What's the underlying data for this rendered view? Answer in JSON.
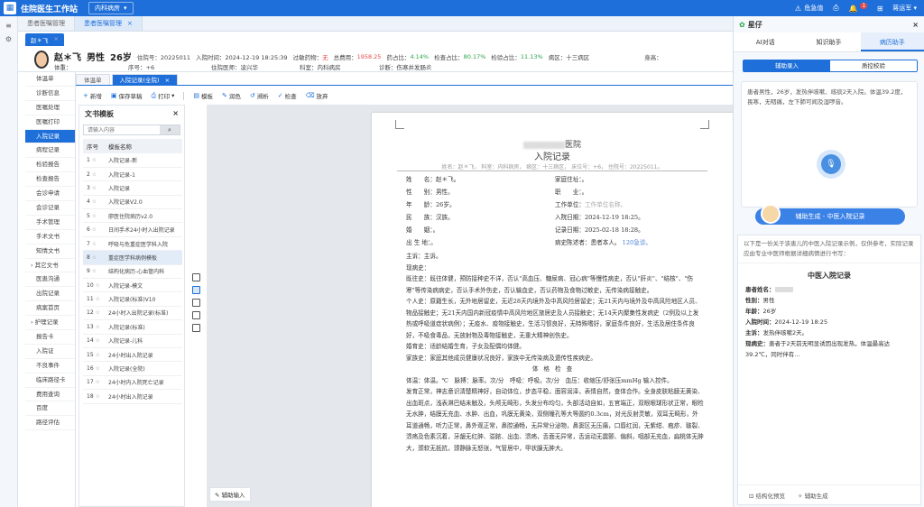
{
  "app": {
    "title": "住院医生工作站",
    "dept": "内科病房",
    "user_status": "危急值",
    "notifications": "1",
    "user": "蒋运军"
  },
  "tabs": [
    "患者医嘱管理",
    "患者医嘱管理"
  ],
  "patient_tab": "赵＊飞",
  "patient": {
    "name": "赵＊飞",
    "gender": "男性",
    "age": "26岁",
    "bed_label": "住院号：20225011",
    "admit_time": "入院时间：2024-12-19 18:25:39",
    "allergy_label": "过敏药物：",
    "allergy_value": "无",
    "total_cost_label": "总费用：",
    "total_cost": "1958.25",
    "drug_ratio_label": "药占比：",
    "drug_ratio": "4.14%",
    "exam_ratio_label": "检查占比：",
    "exam_ratio": "80.17%",
    "test_ratio_label": "检验占比：",
    "test_ratio": "11.13%",
    "ward": "病区：十三病区",
    "id_label": "身高：",
    "weight_label": "体重：",
    "seq": "序号：+6",
    "doctor": "住院医师：凌兴华",
    "dept_label": "科室：内科病房",
    "diag": "诊断：伤寒并发肠炎"
  },
  "sidenav": [
    "体温单",
    "诊断信息",
    "医嘱处理",
    "医嘱打印",
    "入院记录",
    "病程记录",
    "检验报告",
    "检查报告",
    "会诊申请",
    "会诊记录",
    "手术管理",
    "手术文书",
    "知情文书",
    "其它文书",
    "医患沟通",
    "出院记录",
    "病案首页",
    "护理记录",
    "报告卡",
    "入院证",
    "不良事件",
    "临床路径卡",
    "费用查询",
    "百度",
    "路径评估"
  ],
  "record_tabs": [
    "体温单",
    "入院记录(全院)"
  ],
  "toolbar": [
    "新增",
    "保存草稿",
    "打印",
    "模板",
    "润色",
    "溯析",
    "检查",
    "放弃"
  ],
  "template_panel": {
    "title": "文书模板",
    "search_placeholder": "请输入内容",
    "col_no": "序号",
    "col_name": "模板名称",
    "rows": [
      {
        "no": "1",
        "name": "入院记录-新"
      },
      {
        "no": "2",
        "name": "入院记录-1"
      },
      {
        "no": "3",
        "name": "入院记录"
      },
      {
        "no": "4",
        "name": "入院记录V2.0"
      },
      {
        "no": "5",
        "name": "廖医住院病历v2.0"
      },
      {
        "no": "6",
        "name": "日间手术24小时入出院记录"
      },
      {
        "no": "7",
        "name": "呼吸与危重症医学科入院"
      },
      {
        "no": "8",
        "name": "重症医学科病例模板"
      },
      {
        "no": "9",
        "name": "结构化病历-心血管内科"
      },
      {
        "no": "10",
        "name": "入院记录-模文"
      },
      {
        "no": "11",
        "name": "入院记录(标准)V10"
      },
      {
        "no": "12",
        "name": "24小时入出院记录(标准)"
      },
      {
        "no": "13",
        "name": "入院记录(标准)"
      },
      {
        "no": "14",
        "name": "入院记录-儿科"
      },
      {
        "no": "15",
        "name": "24小时出入院记录"
      },
      {
        "no": "16",
        "name": "入院记录(全院)"
      },
      {
        "no": "17",
        "name": "24小时内入院死亡记录"
      },
      {
        "no": "18",
        "name": "24小时出入院记录"
      }
    ]
  },
  "doc": {
    "hospital_suffix": "医院",
    "title": "入院记录",
    "meta": "姓名：赵＊飞，  科室：内科病房，  病区：十三病区，  床位号：+6，  住院号：20225011。",
    "f_name_l": "姓　　名：",
    "f_name": "赵＊飞。",
    "f_addr_l": "家庭住址：",
    "f_addr": "。",
    "f_gender_l": "性　　别：",
    "f_gender": "男性。",
    "f_job_l": "职　　业：",
    "f_job": "。",
    "f_age_l": "年　　龄：",
    "f_age": "26岁。",
    "f_work_l": "工作单位：",
    "f_work": "工作单位名称。",
    "f_nation_l": "民　　族：",
    "f_nation": "汉族。",
    "f_admit_l": "入院日期：",
    "f_admit": "2024-12-19 18:25。",
    "f_marry_l": "婚　　姻：",
    "f_marry": "。",
    "f_record_l": "记录日期：",
    "f_record": "2025-02-18 18:28。",
    "f_birth_l": "出 生 地：",
    "f_birth": "。",
    "f_narr_l": "病史陈述者：",
    "f_narr": "患者本人。",
    "f_rel": "120急诊。",
    "complaint": "主诉：主诉。",
    "hpi": "现病史：",
    "past": "既往史：既往体健，预防接种史不详，否认\"高血压、糖尿病、冠心病\"等慢性病史，否认\"肝炎\"、\"结核\"、\"伤寒\"等传染病病史，否认手术外伤史，否认输血史，否认药物及食物过敏史，无传染病接触史。",
    "personal": "个人史：原籍生长，无外地居留史，无近28天内境外及中高风险居留史；无21天内与境外及中高风险地区人员、物品接触史；无21天内国内新冠疫情中高风险地区旅居史及人员接触史；无14天内聚集性发病史（2例及以上发热或呼吸道症状病例）；无疫水、疫物接触史，生活习惯良好，无特殊嗜好，家庭条件良好，生活及居住条件良好，不吸食毒品，无放射物及毒物接触史，无重大精神创伤史。",
    "marital": "婚育史：适龄结婚生育，子女及配偶均体健。",
    "family": "家族史：家庭其他成员健康状况良好，家族中无传染病及遗传性疾病史。",
    "exam_title": "体格检查",
    "vitals": "体温：体温。℃　脉搏：脉率。次/分　呼吸：呼吸。次/分　血压：收缩压/舒张压mmHg 输入控件。",
    "exam": "发育正常，神志意识清楚精神好，自动体位，步态平稳，面容润泽，表情自然，查体合作。全身皮肤粘膜无黄染、出血斑点，浅表淋巴结未触及，头颅无畸形，头发分布均匀，头部活动自如，五官端正，双眼眼球形状正常，眼睑无水肿，结膜无充血、水肿、出血，巩膜无黄染，双侧瞳孔等大等圆约0.3cm，对光反射灵敏，双耳无畸形，外耳道通畅，听力正常，鼻外观正常，鼻腔通畅，无异常分泌物，鼻窦区无压痛，口唇红润，无紫绀、疱疹、皲裂、溃疡及色素沉着，牙龈无红肿、溢脓、出血、溃疡，舌面无异常，舌运动无震颤、偏斜，咽部无充血，扁桃体无肿大，颈软无抵抗，颈静脉无怒张，气管居中，甲状腺无肿大。"
  },
  "bottom_tip": "辅助输入",
  "assistant": {
    "title": "星仔",
    "tabs": [
      "AI对话",
      "知识助手",
      "病历助手"
    ],
    "seg": [
      "辅助录入",
      "质控校验"
    ],
    "note": "患者男性，26岁，发热伴咳嗽、咳痰2天入院。体温39.2度，畏寒，无咽痛，左下肺可闻及湿啰音。",
    "gen_button": "辅助生成 - 中医入院记录",
    "intro": "以下是一份关于该患儿的中医入院记录示例，仅供参考，实际记录应由专业中医师根据详细病情进行书写：",
    "record_title": "中医入院记录",
    "rows": [
      {
        "k": "患者姓名：",
        "v": ""
      },
      {
        "k": "性别：",
        "v": "男性"
      },
      {
        "k": "年龄：",
        "v": "26岁"
      },
      {
        "k": "入院时间：",
        "v": "2024-12-19 18:25"
      },
      {
        "k": "主诉：",
        "v": "发热伴咳嗽2天。"
      },
      {
        "k": "现病史：",
        "v": "患者于2天前无明显诱因出现发热，体温最高达39.2℃，同时伴有..."
      }
    ],
    "foot": [
      "结构化预览",
      "辅助生成"
    ]
  }
}
